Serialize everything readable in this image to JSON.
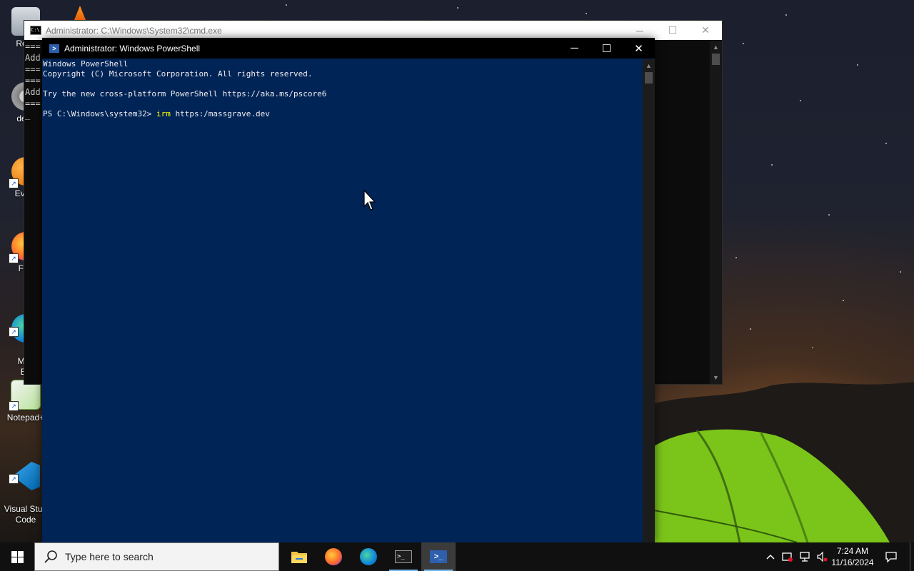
{
  "desktop": {
    "icons": [
      {
        "label": "Recy"
      },
      {
        "label": "desk"
      },
      {
        "label": "Every"
      },
      {
        "label": "Fire"
      },
      {
        "label": "Micr\nEd"
      },
      {
        "label": "Notepad+"
      },
      {
        "label": "Visual Stud\nCode"
      }
    ]
  },
  "cmd_window": {
    "title": "Administrator: C:\\Windows\\System32\\cmd.exe",
    "lines": [
      "===",
      "Add",
      "===",
      "",
      "===",
      "Add",
      "===",
      "",
      "_"
    ]
  },
  "ps_window": {
    "title": "Administrator: Windows PowerShell",
    "lines": [
      "Windows PowerShell",
      "Copyright (C) Microsoft Corporation. All rights reserved.",
      "",
      "Try the new cross-platform PowerShell https://aka.ms/pscore6",
      ""
    ],
    "prompt": "PS C:\\Windows\\system32> ",
    "command": "irm",
    "argument": " https:/massgrave.dev",
    "controls": {
      "minimize": "─",
      "maximize": "☐",
      "close": "✕"
    }
  },
  "taskbar": {
    "search_placeholder": "Type here to search",
    "time": "7:24 AM",
    "date": "11/16/2024",
    "apps": [
      "file-explorer",
      "firefox",
      "edge",
      "terminal",
      "powershell"
    ]
  }
}
